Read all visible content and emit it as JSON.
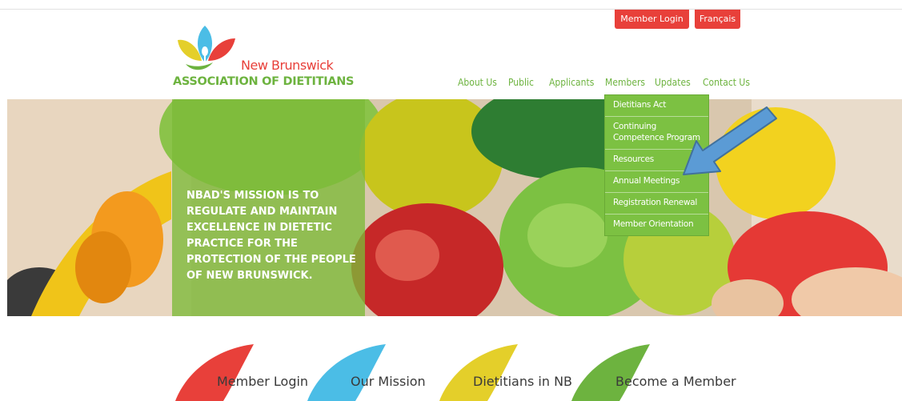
{
  "header": {
    "member_login": "Member Login",
    "language": "Français"
  },
  "logo": {
    "line1": "New Brunswick",
    "line2": "ASSOCIATION OF DIETITIANS"
  },
  "nav": {
    "items": [
      "About Us",
      "Public",
      "Applicants",
      "Members",
      "Updates",
      "Contact Us"
    ]
  },
  "members_menu": {
    "items": [
      "Dietitians Act",
      "Continuing Competence Program",
      "Resources",
      "Annual Meetings",
      "Registration Renewal",
      "Member Orientation"
    ]
  },
  "hero": {
    "mission": "NBAD'S MISSION IS TO REGULATE AND MAINTAIN EXCELLENCE IN DIETETIC PRACTICE FOR THE PROTECTION OF THE PEOPLE OF NEW BRUNSWICK."
  },
  "quicklinks": {
    "items": [
      "Member Login",
      "Our Mission",
      "Dietitians in NB",
      "Become a Member"
    ]
  },
  "colors": {
    "red": "#e8403a",
    "green": "#6db33f",
    "blue": "#4bbde6",
    "yellow": "#e4cf2a",
    "arrow": "#5b9bd5"
  }
}
